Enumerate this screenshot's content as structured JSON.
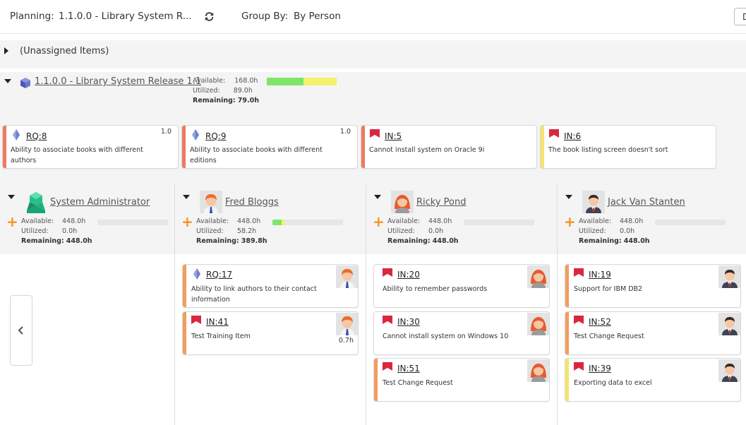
{
  "toolbar": {
    "planning_label": "Planning:",
    "release_value": "1.1.0.0 - Library System R...",
    "group_by_label": "Group By:",
    "group_by_value": "By Person",
    "right_button_label": "D"
  },
  "unassigned": {
    "label": "(Unassigned Items)"
  },
  "release": {
    "title": "1.1.0.0 - Library System Release 1.1",
    "available_label": "Available:",
    "available": "168.0h",
    "utilized_label": "Utilized:",
    "utilized": "89.0h",
    "remaining_label": "Remaining:",
    "remaining": "79.0h",
    "progress": {
      "utilized_fraction": 0.53,
      "remaining_fraction": 0.47
    }
  },
  "release_cards": [
    {
      "key": "RQ:8",
      "type": "requirement",
      "desc": "Ability to associate books with different authors",
      "meta": "1.0",
      "strip_color": "#ee7a63"
    },
    {
      "key": "RQ:9",
      "type": "requirement",
      "desc": "Ability to associate books with different editions",
      "meta": "1.0",
      "strip_color": "#ee7a63"
    },
    {
      "key": "IN:5",
      "type": "incident",
      "desc": "Cannot install system on Oracle 9i",
      "meta": "",
      "strip_color": "#ee7a63"
    },
    {
      "key": "IN:6",
      "type": "incident",
      "desc": "The book listing screen doesn't sort",
      "meta": "",
      "strip_color": "#f4e46a"
    }
  ],
  "people": [
    {
      "name": "System Administrator",
      "avatar": "admin-cube",
      "available_label": "Available:",
      "available": "448.0h",
      "utilized_label": "Utilized:",
      "utilized": "0.0h",
      "remaining_label": "Remaining:",
      "remaining": "448.0h",
      "utilized_fraction": 0.0,
      "cards": []
    },
    {
      "name": "Fred Bloggs",
      "avatar": "man-orange-hair",
      "available_label": "Available:",
      "available": "448.0h",
      "utilized_label": "Utilized:",
      "utilized": "58.2h",
      "remaining_label": "Remaining:",
      "remaining": "389.8h",
      "utilized_fraction": 0.13,
      "cards": [
        {
          "key": "RQ:17",
          "type": "requirement",
          "desc": "Ability to link authors to their contact information",
          "meta": "",
          "strip_color": "#f29e5c"
        },
        {
          "key": "IN:41",
          "type": "incident",
          "desc": "Test Training Item",
          "meta": "0.7h",
          "strip_color": "#f29e5c"
        }
      ]
    },
    {
      "name": "Ricky Pond",
      "avatar": "woman-orange-hair",
      "available_label": "Available:",
      "available": "448.0h",
      "utilized_label": "Utilized:",
      "utilized": "0.0h",
      "remaining_label": "Remaining:",
      "remaining": "448.0h",
      "utilized_fraction": 0.0,
      "cards": [
        {
          "key": "IN:20",
          "type": "incident",
          "desc": "Ability to remember passwords",
          "meta": "",
          "strip_color": "#ffffff"
        },
        {
          "key": "IN:30",
          "type": "incident",
          "desc": "Cannot install system on Windows 10",
          "meta": "",
          "strip_color": "#ffffff"
        },
        {
          "key": "IN:51",
          "type": "incident",
          "desc": "Test Change Request",
          "meta": "",
          "strip_color": "#f29e5c"
        }
      ]
    },
    {
      "name": "Jack Van Stanten",
      "avatar": "man-dark-suit",
      "available_label": "Available:",
      "available": "448.0h",
      "utilized_label": "Utilized:",
      "utilized": "0.0h",
      "remaining_label": "Remaining:",
      "remaining": "448.0h",
      "utilized_fraction": 0.0,
      "cards": [
        {
          "key": "IN:19",
          "type": "incident",
          "desc": "Support for IBM DB2",
          "meta": "",
          "strip_color": "#f29e5c"
        },
        {
          "key": "IN:52",
          "type": "incident",
          "desc": "Test Change Request",
          "meta": "",
          "strip_color": "#f29e5c"
        },
        {
          "key": "IN:39",
          "type": "incident",
          "desc": "Exporting data to excel",
          "meta": "",
          "strip_color": "#f4e46a"
        }
      ]
    }
  ],
  "colors": {
    "accent_orange": "#f39324",
    "progress_green": "#7ee66b",
    "progress_yellow": "#f4f16a",
    "incident_red": "#d9283e",
    "requirement_blue": "#7b8ed8"
  },
  "icons": {
    "refresh": "refresh-icon",
    "release": "release-cube-icon",
    "requirement": "requirement-diamond-icon",
    "incident": "incident-flag-icon",
    "add": "plus-icon",
    "nav_prev": "chevron-left-icon"
  }
}
